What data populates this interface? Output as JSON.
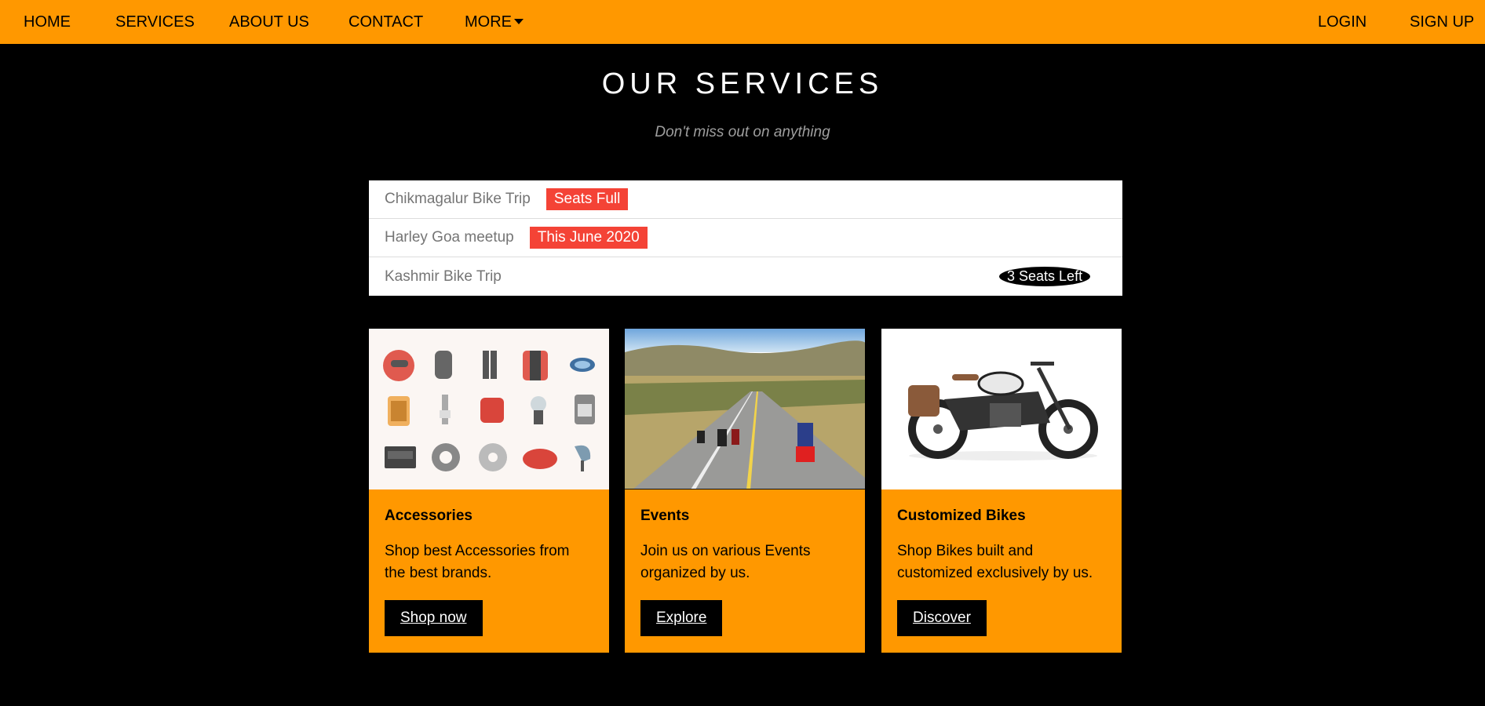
{
  "nav": {
    "home": "HOME",
    "services": "SERVICES",
    "about": "ABOUT US",
    "contact": "CONTACT",
    "more": "MORE",
    "login": "LOGIN",
    "signup": "SIGN UP"
  },
  "header": {
    "title": "OUR SERVICES",
    "subtitle": "Don't miss out on anything"
  },
  "events_list": [
    {
      "name": "Chikmagalur Bike Trip",
      "tag": "Seats Full"
    },
    {
      "name": "Harley Goa meetup",
      "tag": "This June 2020"
    },
    {
      "name": "Kashmir Bike Trip",
      "badge": "3 Seats Left"
    }
  ],
  "cards": [
    {
      "title": "Accessories",
      "text": "Shop best Accessories from the best brands.",
      "button": "Shop now"
    },
    {
      "title": "Events",
      "text": "Join us on various Events organized by us.",
      "button": "Explore"
    },
    {
      "title": "Customized Bikes",
      "text": "Shop Bikes built and customized exclusively by us.",
      "button": "Discover"
    }
  ],
  "colors": {
    "accent": "#ff9800",
    "background": "#000000",
    "tag": "#f44336"
  }
}
